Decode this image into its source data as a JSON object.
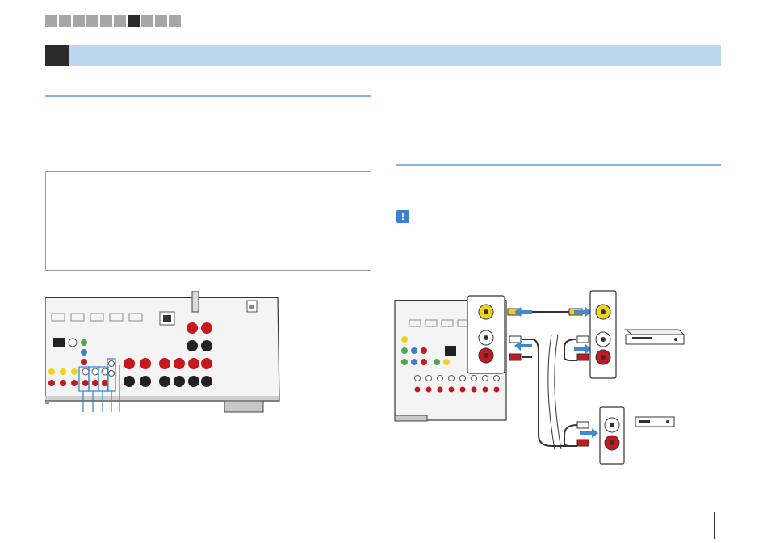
{
  "progress": {
    "total": 11,
    "active_index": 6
  },
  "icons": {
    "caution": "exclamation-icon",
    "caution_glyph": "!"
  },
  "colors": {
    "section_bar": "#bcd6f0",
    "rule": "#86b2de",
    "arrow": "#3f8ad2",
    "video_yellow": "#f1d31b",
    "audio_red": "#c7171f"
  }
}
